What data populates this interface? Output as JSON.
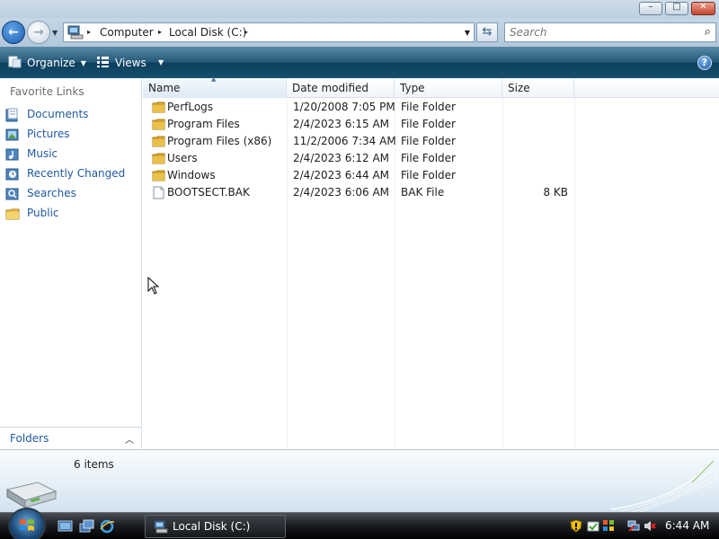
{
  "window": {
    "minimize_glyph": "–",
    "maximize_glyph": "□",
    "close_glyph": "✕"
  },
  "address_bar": {
    "breadcrumbs": [
      "Computer",
      "Local Disk (C:)"
    ],
    "separator": "▸",
    "dropdown_glyph": "▼",
    "refresh_glyph": "⇆"
  },
  "search": {
    "placeholder": "Search",
    "icon": "magnifier-icon"
  },
  "command_bar": {
    "organize_label": "Organize",
    "views_label": "Views",
    "dropdown_glyph": "▼",
    "help_glyph": "?"
  },
  "nav_pane": {
    "heading": "Favorite Links",
    "links": [
      {
        "label": "Documents",
        "icon": "documents-icon"
      },
      {
        "label": "Pictures",
        "icon": "pictures-icon"
      },
      {
        "label": "Music",
        "icon": "music-icon"
      },
      {
        "label": "Recently Changed",
        "icon": "recently-changed-icon"
      },
      {
        "label": "Searches",
        "icon": "searches-icon"
      },
      {
        "label": "Public",
        "icon": "public-folder-icon"
      }
    ],
    "folders_label": "Folders",
    "folders_glyph": "︿"
  },
  "file_list": {
    "columns": [
      "Name",
      "Date modified",
      "Type",
      "Size"
    ],
    "sort_glyph": "▲",
    "rows": [
      {
        "name": "PerfLogs",
        "date": "1/20/2008 7:05 PM",
        "type": "File Folder",
        "size": "",
        "icon": "folder-icon"
      },
      {
        "name": "Program Files",
        "date": "2/4/2023 6:15 AM",
        "type": "File Folder",
        "size": "",
        "icon": "folder-icon"
      },
      {
        "name": "Program Files (x86)",
        "date": "11/2/2006 7:34 AM",
        "type": "File Folder",
        "size": "",
        "icon": "folder-icon"
      },
      {
        "name": "Users",
        "date": "2/4/2023 6:12 AM",
        "type": "File Folder",
        "size": "",
        "icon": "folder-icon"
      },
      {
        "name": "Windows",
        "date": "2/4/2023 6:44 AM",
        "type": "File Folder",
        "size": "",
        "icon": "folder-icon"
      },
      {
        "name": "BOOTSECT.BAK",
        "date": "2/4/2023 6:06 AM",
        "type": "BAK File",
        "size": "8 KB",
        "icon": "file-icon"
      }
    ]
  },
  "details_pane": {
    "item_count": "6 items"
  },
  "taskbar": {
    "active_window": "Local Disk (C:)",
    "clock": "6:44 AM"
  },
  "colors": {
    "link_blue": "#1f5aa0",
    "command_bar_dark": "#14506f",
    "folder_yellow": "#e8c04a"
  }
}
